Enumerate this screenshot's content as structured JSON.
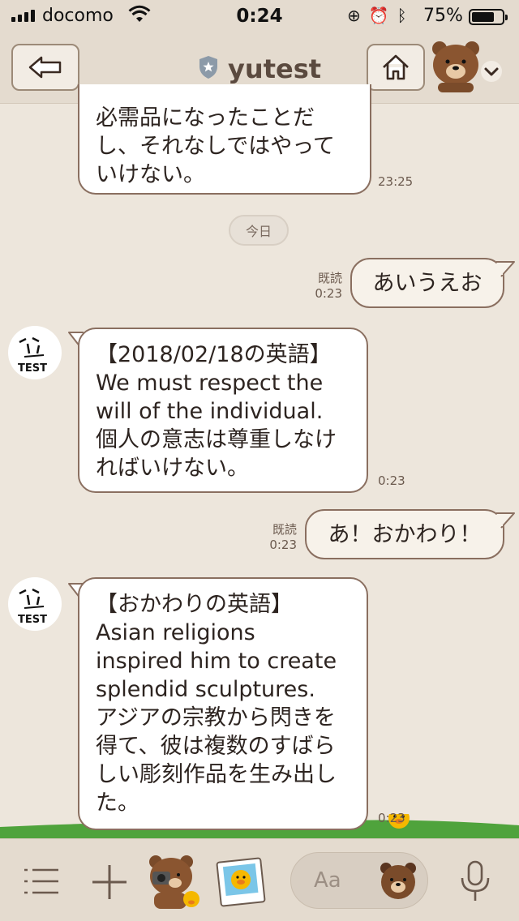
{
  "status_bar": {
    "carrier": "docomo",
    "time": "0:24",
    "battery": "75%",
    "battery_level": 0.75
  },
  "header": {
    "title": "yutest",
    "back_icon": "back-arrow-icon",
    "home_icon": "home-icon",
    "menu_icon": "chevron-down-icon"
  },
  "messages": [
    {
      "text": "必需品になったことだ\nし、それなしではやって\nいけない。",
      "time": "23:25"
    },
    {
      "date_chip": "今日"
    },
    {
      "text": "あいうえお",
      "read": "既読",
      "time": "0:23"
    },
    {
      "text": "【2018/02/18の英語】\nWe must respect the\nwill of the individual.\n個人の意志は尊重しなけ\nればいけない。",
      "time": "0:23"
    },
    {
      "text": "あ！おかわり！",
      "read": "既読",
      "time": "0:23"
    },
    {
      "text": "【おかわりの英語】\nAsian religions\ninspired him to create\nsplendid sculptures.\nアジアの宗教から閃きを\n得て、彼は複数のすばら\nしい彫刻作品を生み出し\nた。",
      "time": "0:23"
    }
  ],
  "avatar_text": "TEST",
  "input": {
    "placeholder": "Aa"
  },
  "colors": {
    "background": "#ede6dc",
    "bar": "#e4dbcf",
    "bubble_border": "#8a6f60"
  }
}
